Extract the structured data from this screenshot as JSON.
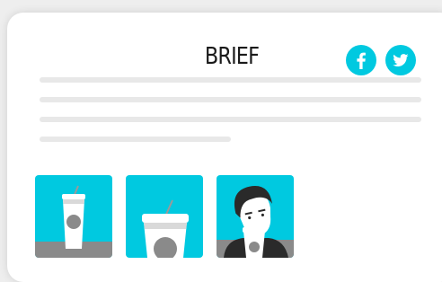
{
  "article": {
    "title": "BRIEF"
  },
  "social": {
    "facebook_icon": "facebook-icon",
    "twitter_icon": "twitter-icon",
    "accent_color": "#00c9e0"
  },
  "thumbnails": {
    "items": [
      {
        "icon": "cup-icon"
      },
      {
        "icon": "cup-icon"
      },
      {
        "icon": "person-with-cup-icon"
      }
    ]
  }
}
